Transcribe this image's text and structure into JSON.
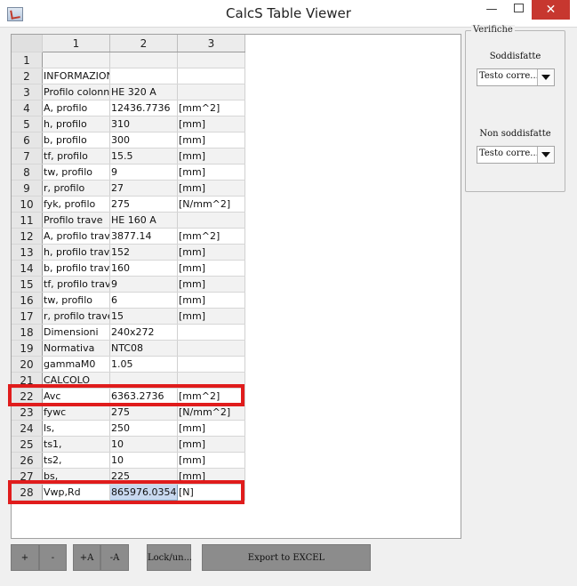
{
  "window": {
    "title": "CalcS Table Viewer",
    "minimize_label": "—",
    "close_label": "✕"
  },
  "table": {
    "columns": [
      "1",
      "2",
      "3"
    ],
    "rows": [
      {
        "n": "1",
        "c1": "",
        "c2": "",
        "c3": ""
      },
      {
        "n": "2",
        "c1": "INFORMAZIONI",
        "c2": "",
        "c3": ""
      },
      {
        "n": "3",
        "c1": "Profilo colonna",
        "c2": "HE 320 A",
        "c3": ""
      },
      {
        "n": "4",
        "c1": "A, profilo",
        "c2": "12436.7736",
        "c3": "[mm^2]"
      },
      {
        "n": "5",
        "c1": "h, profilo",
        "c2": "310",
        "c3": "[mm]"
      },
      {
        "n": "6",
        "c1": "b, profilo",
        "c2": "300",
        "c3": "[mm]"
      },
      {
        "n": "7",
        "c1": "tf, profilo",
        "c2": "15.5",
        "c3": "[mm]"
      },
      {
        "n": "8",
        "c1": "tw, profilo",
        "c2": "9",
        "c3": "[mm]"
      },
      {
        "n": "9",
        "c1": "r, profilo",
        "c2": "27",
        "c3": "[mm]"
      },
      {
        "n": "10",
        "c1": "fyk, profilo",
        "c2": "275",
        "c3": "[N/mm^2]"
      },
      {
        "n": "11",
        "c1": "Profilo trave",
        "c2": "HE 160 A",
        "c3": ""
      },
      {
        "n": "12",
        "c1": "A, profilo trave",
        "c2": "3877.14",
        "c3": "[mm^2]"
      },
      {
        "n": "13",
        "c1": "h, profilo trave",
        "c2": "152",
        "c3": "[mm]"
      },
      {
        "n": "14",
        "c1": "b, profilo trave",
        "c2": "160",
        "c3": "[mm]"
      },
      {
        "n": "15",
        "c1": "tf, profilo trave",
        "c2": "9",
        "c3": "[mm]"
      },
      {
        "n": "16",
        "c1": "tw, profilo",
        "c2": "6",
        "c3": "[mm]"
      },
      {
        "n": "17",
        "c1": "r, profilo trave",
        "c2": "15",
        "c3": "[mm]"
      },
      {
        "n": "18",
        "c1": "Dimensioni",
        "c2": "240x272",
        "c3": ""
      },
      {
        "n": "19",
        "c1": "Normativa",
        "c2": "NTC08",
        "c3": ""
      },
      {
        "n": "20",
        "c1": "gammaM0",
        "c2": "1.05",
        "c3": ""
      },
      {
        "n": "21",
        "c1": "CALCOLO",
        "c2": "",
        "c3": ""
      },
      {
        "n": "22",
        "c1": "Avc",
        "c2": "6363.2736",
        "c3": "[mm^2]"
      },
      {
        "n": "23",
        "c1": "fywc",
        "c2": "275",
        "c3": "[N/mm^2]"
      },
      {
        "n": "24",
        "c1": "ls,",
        "c2": "250",
        "c3": "[mm]"
      },
      {
        "n": "25",
        "c1": "ts1,",
        "c2": "10",
        "c3": "[mm]"
      },
      {
        "n": "26",
        "c1": "ts2,",
        "c2": "10",
        "c3": "[mm]"
      },
      {
        "n": "27",
        "c1": "bs,",
        "c2": "225",
        "c3": "[mm]"
      },
      {
        "n": "28",
        "c1": "Vwp,Rd",
        "c2": "865976.0354",
        "c3": "[N]"
      }
    ],
    "selected_cell": "28-c2"
  },
  "verifiche": {
    "title": "Verifiche",
    "soddisfatte_label": "Soddisfatte",
    "soddisfatte_value": "Testo corre...",
    "non_soddisfatte_label": "Non soddisfatte",
    "non_soddisfatte_value": "Testo corre..."
  },
  "buttons": {
    "add_row": "+",
    "remove_row": "-",
    "add_col": "+A",
    "remove_col": "-A",
    "lock": "Lock/un...",
    "export": "Export to EXCEL"
  },
  "colors": {
    "highlight": "#e01c1c",
    "selection": "#c8d8ef",
    "close_button": "#c7372f"
  }
}
